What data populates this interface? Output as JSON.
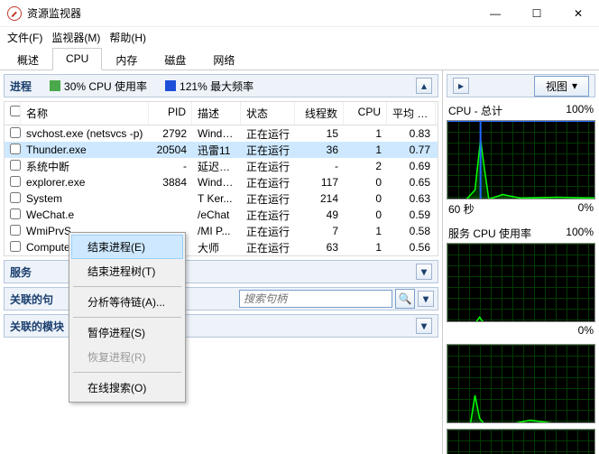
{
  "window": {
    "title": "资源监视器"
  },
  "winbtns": {
    "min": "—",
    "max": "☐",
    "close": "✕"
  },
  "menu": {
    "file": "文件(F)",
    "monitor": "监视器(M)",
    "help": "帮助(H)"
  },
  "tabs": {
    "overview": "概述",
    "cpu": "CPU",
    "memory": "内存",
    "disk": "磁盘",
    "network": "网络"
  },
  "process_header": {
    "label": "进程",
    "cpu_box": "#4aa94a",
    "cpu_text": "30% CPU 使用率",
    "freq_box": "#1e4fd8",
    "freq_text": "121% 最大频率",
    "chevron": "▴"
  },
  "cols": {
    "name": "名称",
    "pid": "PID",
    "desc": "描述",
    "status": "状态",
    "threads": "线程数",
    "cpu": "CPU",
    "avg": "平均 C..."
  },
  "rows": [
    {
      "name": "svchost.exe (netsvcs -p)",
      "pid": "2792",
      "desc": "Windo...",
      "status": "正在运行",
      "threads": "15",
      "cpu": "1",
      "avg": "0.83"
    },
    {
      "name": "Thunder.exe",
      "pid": "20504",
      "desc": "迅雷11",
      "status": "正在运行",
      "threads": "36",
      "cpu": "1",
      "avg": "0.77",
      "selected": true
    },
    {
      "name": "系统中断",
      "pid": "-",
      "desc": "延迟过...",
      "status": "正在运行",
      "threads": "-",
      "cpu": "2",
      "avg": "0.69"
    },
    {
      "name": "explorer.exe",
      "pid": "3884",
      "desc": "Windo...",
      "status": "正在运行",
      "threads": "117",
      "cpu": "0",
      "avg": "0.65"
    },
    {
      "name": "System",
      "pid": "",
      "desc": "T Ker...",
      "status": "正在运行",
      "threads": "214",
      "cpu": "0",
      "avg": "0.63"
    },
    {
      "name": "WeChat.e",
      "pid": "",
      "desc": "/eChat",
      "status": "正在运行",
      "threads": "49",
      "cpu": "0",
      "avg": "0.59"
    },
    {
      "name": "WmiPrvS",
      "pid": "",
      "desc": "/MI P...",
      "status": "正在运行",
      "threads": "7",
      "cpu": "1",
      "avg": "0.58"
    },
    {
      "name": "Compute",
      "pid": "",
      "desc": "大师",
      "status": "正在运行",
      "threads": "63",
      "cpu": "1",
      "avg": "0.56"
    }
  ],
  "ctx": {
    "end": "结束进程(E)",
    "end_tree": "结束进程树(T)",
    "analyze": "分析等待链(A)...",
    "suspend": "暂停进程(S)",
    "resume": "恢复进程(R)",
    "search": "在线搜索(O)"
  },
  "services": {
    "label": "服务",
    "chevron": "▾"
  },
  "handles": {
    "label": "关联的句",
    "placeholder": "搜索句柄",
    "search_icon": "🔍",
    "chevron": "▾"
  },
  "modules": {
    "label": "关联的模块",
    "chevron": "▾"
  },
  "rp": {
    "view": "视图",
    "dd": "▾",
    "chev": "▸",
    "chart1_title": "CPU - 总计",
    "chart1_right": "100%",
    "chart1_foot_l": "60 秒",
    "chart1_foot_r": "0%",
    "chart2_title": "服务 CPU 使用率",
    "chart2_right": "100%",
    "chart2_foot_r": "0%"
  }
}
